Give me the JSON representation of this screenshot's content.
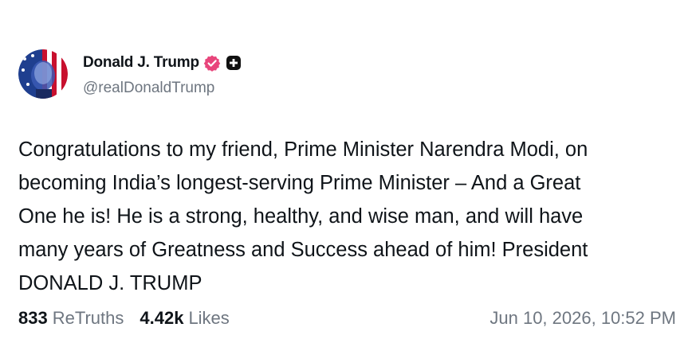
{
  "author": {
    "display_name": "Donald J. Trump",
    "handle": "@realDonaldTrump",
    "avatar_icon": "flag-portrait-avatar",
    "verified_icon": "verified-badge-icon",
    "verified_color": "#e8457b",
    "extra_badge_icon": "plus-badge-icon"
  },
  "post": {
    "text": "Congratulations to my friend, Prime Minister Narendra Modi, on\nbecoming India’s longest-serving Prime Minister – And a Great\nOne he is! He is a strong, healthy, and wise man, and will have\nmany years of Greatness and Success ahead of him! President\nDONALD J. TRUMP"
  },
  "stats": {
    "retruths_count": "833",
    "retruths_label": "ReTruths",
    "likes_count": "4.42k",
    "likes_label": "Likes"
  },
  "timestamp": "Jun 10, 2026, 10:52 PM",
  "colors": {
    "text_primary": "#0f1419",
    "text_secondary": "#6e7680",
    "background": "#ffffff"
  }
}
